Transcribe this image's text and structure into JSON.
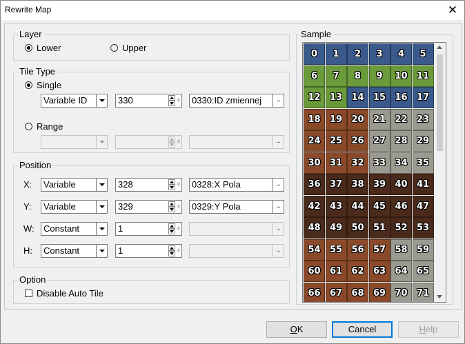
{
  "window": {
    "title": "Rewrite Map",
    "close_glyph": "✕"
  },
  "layer": {
    "legend": "Layer",
    "options": [
      {
        "label": "Lower",
        "checked": true
      },
      {
        "label": "Upper",
        "checked": false
      }
    ]
  },
  "tile_type": {
    "legend": "Tile Type",
    "single": {
      "label": "Single",
      "checked": true,
      "source": "Variable ID",
      "value": "330",
      "field": "0330:ID zmiennej"
    },
    "range": {
      "label": "Range",
      "checked": false
    }
  },
  "position": {
    "legend": "Position",
    "rows": [
      {
        "label": "X:",
        "source": "Variable",
        "value": "328",
        "field": "0328:X Pola"
      },
      {
        "label": "Y:",
        "source": "Variable",
        "value": "329",
        "field": "0329:Y Pola"
      },
      {
        "label": "W:",
        "source": "Constant",
        "value": "1",
        "field": ""
      },
      {
        "label": "H:",
        "source": "Constant",
        "value": "1",
        "field": ""
      }
    ]
  },
  "option": {
    "legend": "Option",
    "disable_auto_tile": {
      "label": "Disable Auto Tile",
      "checked": false
    }
  },
  "sample": {
    "legend": "Sample",
    "tiles": [
      "0",
      "1",
      "2",
      "3",
      "4",
      "5",
      "6",
      "7",
      "8",
      "9",
      "10",
      "11",
      "12",
      "13",
      "14",
      "15",
      "16",
      "17",
      "18",
      "19",
      "20",
      "21",
      "22",
      "23",
      "24",
      "25",
      "26",
      "27",
      "28",
      "29",
      "30",
      "31",
      "32",
      "33",
      "34",
      "35",
      "36",
      "37",
      "38",
      "39",
      "40",
      "41",
      "42",
      "43",
      "44",
      "45",
      "46",
      "47",
      "48",
      "49",
      "50",
      "51",
      "52",
      "53",
      "54",
      "55",
      "56",
      "57",
      "58",
      "59",
      "60",
      "61",
      "62",
      "63",
      "64",
      "65",
      "66",
      "67",
      "68",
      "69",
      "70",
      "71"
    ],
    "colors": {
      "water": "#3a5a8c",
      "grass": "#6a9a3a",
      "wood": "#8a4a2a",
      "stone": "#9a9a90",
      "dark": "#4a2a1a"
    }
  },
  "buttons": {
    "ok": {
      "hot": "O",
      "rest": "K"
    },
    "cancel": "Cancel",
    "help": {
      "hot": "H",
      "rest": "elp"
    }
  }
}
